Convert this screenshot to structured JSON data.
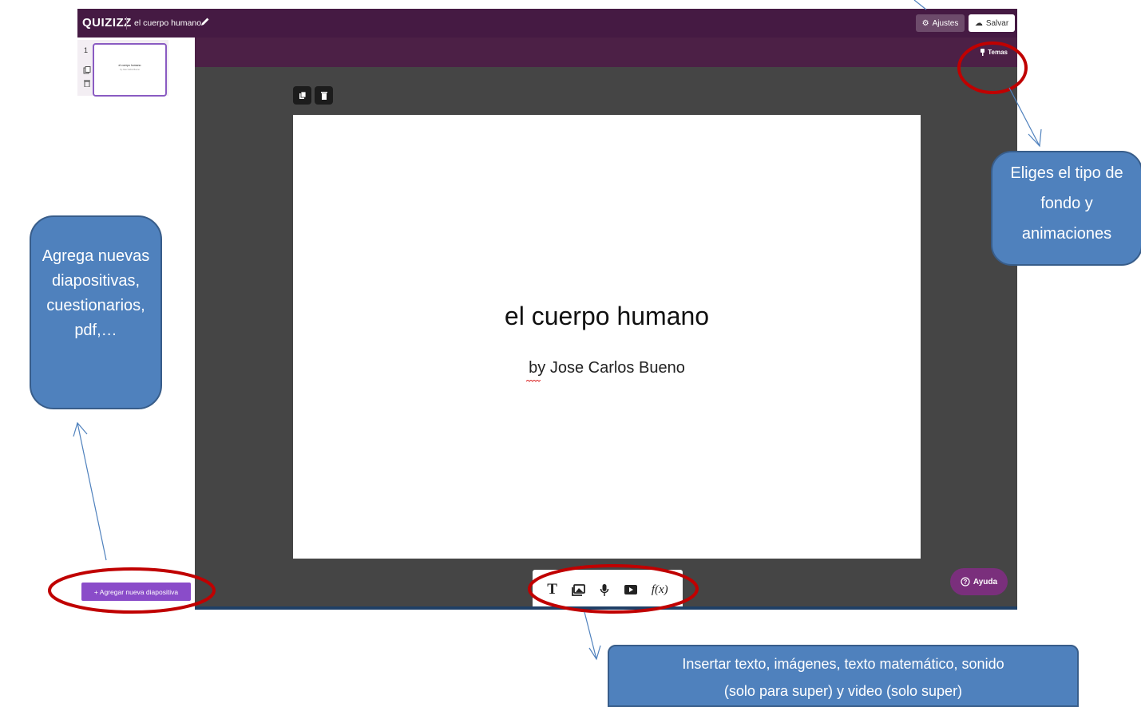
{
  "app": {
    "brand": "QUIZIZZ",
    "quiz_title": "el cuerpo humano",
    "settings_label": "Ajustes",
    "save_label": "Salvar",
    "themes_label": "Temas"
  },
  "sidebar": {
    "slide_number": "1",
    "thumb_title": "el cuerpo humano",
    "thumb_subtitle": "by Jose Carlos Bueno",
    "add_button": "+ Agregar nueva diapositiva"
  },
  "slide": {
    "title": "el cuerpo humano",
    "subtitle": "by Jose Carlos Bueno"
  },
  "insert_tools": [
    "text-icon",
    "image-icon",
    "microphone-icon",
    "video-icon",
    "math-function-icon"
  ],
  "math_glyph": "f(x)",
  "help_label": "Ayuda",
  "annotations": {
    "left": [
      "Agrega nuevas",
      "diapositivas,",
      "cuestionarios,",
      "pdf,…"
    ],
    "right": [
      "Eliges el tipo de",
      "fondo y",
      "animaciones"
    ],
    "bottom": [
      "Insertar texto, imágenes, texto matemático,  sonido",
      "(solo para super) y video (solo super)"
    ]
  },
  "colors": {
    "topbar": "#451a43",
    "canvas": "#454545",
    "accent": "#8a4cc9",
    "callout": "#4f81bd",
    "highlight_ring": "#c00000"
  }
}
